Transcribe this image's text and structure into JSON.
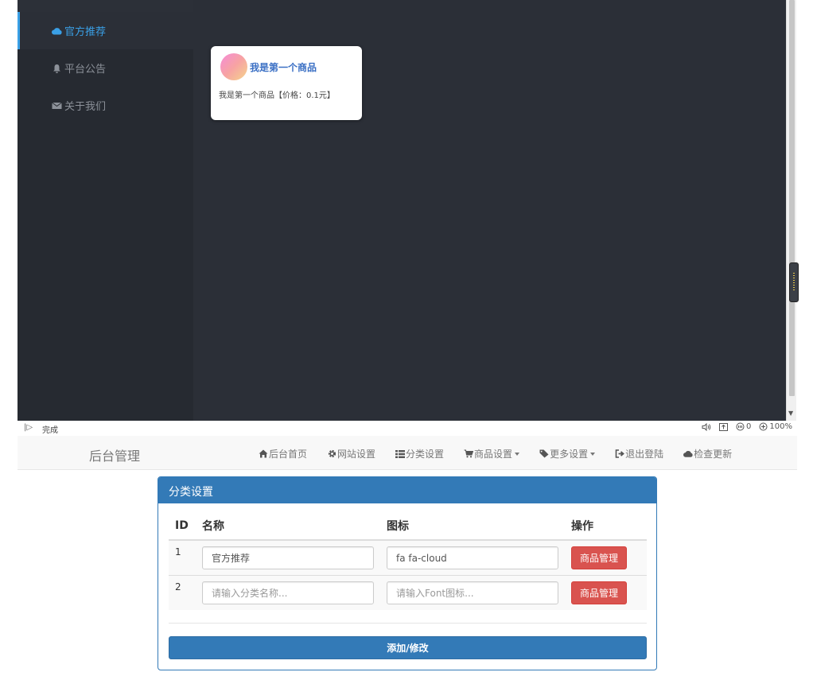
{
  "sidebar": {
    "items": [
      {
        "label": "官方推荐",
        "icon": "cloud-icon",
        "active": true
      },
      {
        "label": "平台公告",
        "icon": "bell-icon",
        "active": false
      },
      {
        "label": "关于我们",
        "icon": "envelope-icon",
        "active": false
      }
    ]
  },
  "product_card": {
    "title": "我是第一个商品",
    "description": "我是第一个商品【价格：0.1元】"
  },
  "statusbar": {
    "status": "完成",
    "badge_count": "0",
    "zoom": "100%"
  },
  "navbar": {
    "brand": "后台管理",
    "items": [
      {
        "label": "后台首页",
        "icon": "home-icon"
      },
      {
        "label": "网站设置",
        "icon": "gear-icon"
      },
      {
        "label": "分类设置",
        "icon": "list-icon"
      },
      {
        "label": "商品设置",
        "icon": "cart-icon",
        "dropdown": true
      },
      {
        "label": "更多设置",
        "icon": "tag-icon",
        "dropdown": true
      },
      {
        "label": "退出登陆",
        "icon": "sign-out-icon"
      },
      {
        "label": "检查更新",
        "icon": "cloud-icon"
      }
    ]
  },
  "panel": {
    "title": "分类设置",
    "columns": [
      "ID",
      "名称",
      "图标",
      "操作"
    ],
    "rows": [
      {
        "id": "1",
        "name_value": "官方推荐",
        "name_placeholder": "",
        "icon_value": "fa fa-cloud",
        "icon_placeholder": "",
        "action": "商品管理"
      },
      {
        "id": "2",
        "name_value": "",
        "name_placeholder": "请输入分类名称...",
        "icon_value": "",
        "icon_placeholder": "请输入Font图标...",
        "action": "商品管理"
      }
    ],
    "submit_label": "添加/修改"
  },
  "colors": {
    "accent": "#3aa0e6",
    "primary": "#337ab7",
    "danger": "#d9534f"
  }
}
